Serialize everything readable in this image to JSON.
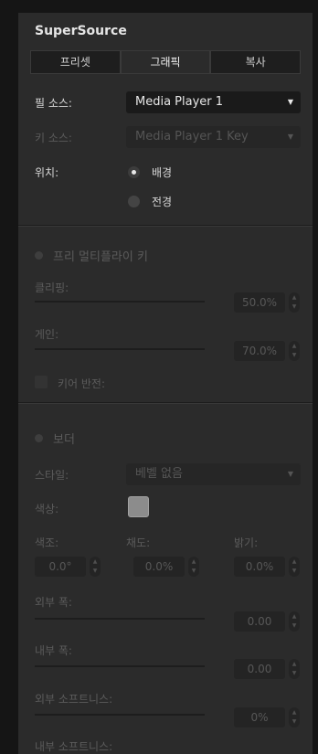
{
  "panel": {
    "title": "SuperSource",
    "tabs": [
      {
        "label": "프리셋",
        "active": false
      },
      {
        "label": "그래픽",
        "active": true
      },
      {
        "label": "복사",
        "active": false
      }
    ]
  },
  "source": {
    "fill_label": "필 소스:",
    "fill_value": "Media Player 1",
    "key_label": "키 소스:",
    "key_value": "Media Player 1 Key",
    "position_label": "위치:",
    "position_options": [
      "배경",
      "전경"
    ],
    "position_selected": "배경"
  },
  "premultiply": {
    "title": "프리 멀티플라이 키",
    "enabled": false,
    "clip_label": "클리핑:",
    "clip_value": "50.0%",
    "gain_label": "게인:",
    "gain_value": "70.0%",
    "invert_label": "키어 반전:"
  },
  "border": {
    "title": "보더",
    "enabled": false,
    "style_label": "스타일:",
    "style_value": "베벨 없음",
    "color_label": "색상:",
    "swatch_color": "#8c8c8c",
    "hue_label": "색조:",
    "hue_value": "0.0°",
    "sat_label": "채도:",
    "sat_value": "0.0%",
    "lum_label": "밝기:",
    "lum_value": "0.0%",
    "outer_width_label": "외부 폭:",
    "outer_width_value": "0.00",
    "inner_width_label": "내부 폭:",
    "inner_width_value": "0.00",
    "outer_soft_label": "외부 소프트니스:",
    "outer_soft_value": "0%",
    "inner_soft_label": "내부 소프트니스:"
  },
  "icons": {
    "caret": "▼",
    "step_up": "▲",
    "step_down": "▼"
  }
}
